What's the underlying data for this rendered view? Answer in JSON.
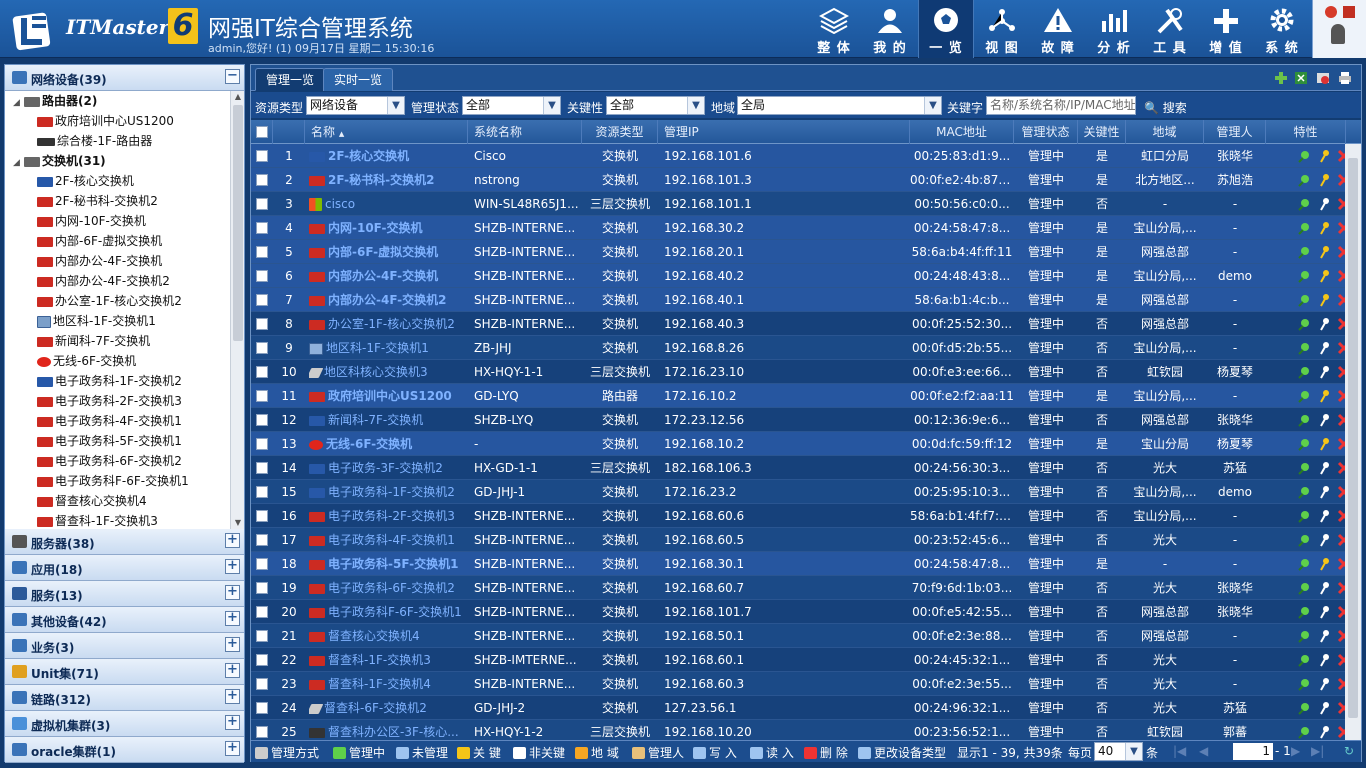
{
  "header": {
    "brand": "ITMaster",
    "brand_num": "6",
    "title": "网强IT综合管理系统",
    "subtitle": "admin,您好! (1) 09月17日 星期二 15:30:16",
    "nav": [
      {
        "label": "整 体",
        "icon": "layers-icon"
      },
      {
        "label": "我 的",
        "icon": "user-icon"
      },
      {
        "label": "一 览",
        "icon": "soccer-icon"
      },
      {
        "label": "视 图",
        "icon": "network-icon"
      },
      {
        "label": "故 障",
        "icon": "warning-icon"
      },
      {
        "label": "分 析",
        "icon": "chart-icon"
      },
      {
        "label": "工 具",
        "icon": "tools-icon"
      },
      {
        "label": "增 值",
        "icon": "plus-icon"
      },
      {
        "label": "系 统",
        "icon": "gear-icon"
      }
    ]
  },
  "sidebar": {
    "sections": [
      {
        "label": "网络设备(39)",
        "icon": "network-device-icon",
        "toggle": "−"
      },
      {
        "label": "服务器(38)",
        "icon": "server-icon",
        "toggle": "+"
      },
      {
        "label": "应用(18)",
        "icon": "app-icon",
        "toggle": "+"
      },
      {
        "label": "服务(13)",
        "icon": "service-icon",
        "toggle": "+"
      },
      {
        "label": "其他设备(42)",
        "icon": "monitor-icon",
        "toggle": "+"
      },
      {
        "label": "业务(3)",
        "icon": "business-icon",
        "toggle": "+"
      },
      {
        "label": "Unit集(71)",
        "icon": "unit-icon",
        "toggle": "+"
      },
      {
        "label": "链路(312)",
        "icon": "link-icon",
        "toggle": "+"
      },
      {
        "label": "虚拟机集群(3)",
        "icon": "cloud-icon",
        "toggle": "+"
      },
      {
        "label": "oracle集群(1)",
        "icon": "db-icon",
        "toggle": "+"
      }
    ],
    "tree": [
      {
        "label": "路由器(2)",
        "level": 0,
        "bold": true,
        "icon": "router-group-icon",
        "exp": "◢"
      },
      {
        "label": "政府培训中心US1200",
        "level": 1,
        "icon": "h3c"
      },
      {
        "label": "综合楼-1F-路由器",
        "level": 1,
        "icon": "dlink"
      },
      {
        "label": "交换机(31)",
        "level": 0,
        "bold": true,
        "icon": "switch-group-icon",
        "exp": "◢"
      },
      {
        "label": "2F-核心交换机",
        "level": 1,
        "icon": "cisco"
      },
      {
        "label": "2F-秘书科-交换机2",
        "level": 1,
        "icon": "h3c"
      },
      {
        "label": "内网-10F-交换机",
        "level": 1,
        "icon": "h3c"
      },
      {
        "label": "内部-6F-虚拟交换机",
        "level": 1,
        "icon": "h3c"
      },
      {
        "label": "内部办公-4F-交换机",
        "level": 1,
        "icon": "h3c"
      },
      {
        "label": "内部办公-4F-交换机2",
        "level": 1,
        "icon": "h3c"
      },
      {
        "label": "办公室-1F-核心交换机2",
        "level": 1,
        "icon": "h3c"
      },
      {
        "label": "地区科-1F-交换机1",
        "level": 1,
        "icon": "pc"
      },
      {
        "label": "新闻科-7F-交换机",
        "level": 1,
        "icon": "h3c"
      },
      {
        "label": "无线-6F-交换机",
        "level": 1,
        "icon": "huawei"
      },
      {
        "label": "电子政务科-1F-交换机2",
        "level": 1,
        "icon": "cisco"
      },
      {
        "label": "电子政务科-2F-交换机3",
        "level": 1,
        "icon": "h3c"
      },
      {
        "label": "电子政务科-4F-交换机1",
        "level": 1,
        "icon": "h3c"
      },
      {
        "label": "电子政务科-5F-交换机1",
        "level": 1,
        "icon": "h3c"
      },
      {
        "label": "电子政务科-6F-交换机2",
        "level": 1,
        "icon": "h3c"
      },
      {
        "label": "电子政务科F-6F-交换机1",
        "level": 1,
        "icon": "h3c"
      },
      {
        "label": "督查核心交换机4",
        "level": 1,
        "icon": "h3c"
      },
      {
        "label": "督查科-1F-交换机3",
        "level": 1,
        "icon": "h3c"
      }
    ]
  },
  "main": {
    "tabs": [
      "管理一览",
      "实时一览"
    ],
    "filter": {
      "type_label": "资源类型",
      "type_value": "网络设备",
      "mgmt_label": "管理状态",
      "mgmt_value": "全部",
      "key_label": "关键性",
      "key_value": "全部",
      "region_label": "地域",
      "region_value": "全局",
      "kw_label": "关键字",
      "kw_placeholder": "名称/系统名称/IP/MAC地址",
      "search": "搜索"
    },
    "columns": [
      "名称",
      "系统名称",
      "资源类型",
      "管理IP",
      "MAC地址",
      "管理状态",
      "关键性",
      "地域",
      "管理人",
      "特性"
    ],
    "sort_indicator": "▲",
    "rows": [
      {
        "n": "1",
        "name": "2F-核心交换机",
        "bold": true,
        "icon": "cisco",
        "sys": "Cisco",
        "type": "交换机",
        "ip": "192.168.101.6",
        "mac": "00:25:83:d1:9...",
        "st": "管理中",
        "key": "是",
        "reg": "虹口分局",
        "mgr": "张晓华"
      },
      {
        "n": "2",
        "name": "2F-秘书科-交换机2",
        "bold": true,
        "icon": "h3c",
        "sys": "nstrong",
        "type": "交换机",
        "ip": "192.168.101.3",
        "mac": "00:0f:e2:4b:87:f4",
        "st": "管理中",
        "key": "是",
        "reg": "北方地区...",
        "mgr": "苏旭浩"
      },
      {
        "n": "3",
        "name": "cisco",
        "bold": false,
        "icon": "ms",
        "sys": "WIN-SL48R65J1...",
        "type": "三层交换机",
        "ip": "192.168.101.1",
        "mac": "00:50:56:c0:0...",
        "st": "管理中",
        "key": "否",
        "reg": "-",
        "mgr": "-"
      },
      {
        "n": "4",
        "name": "内网-10F-交换机",
        "bold": true,
        "icon": "h3c",
        "sys": "SHZB-INTERNE...",
        "type": "交换机",
        "ip": "192.168.30.2",
        "mac": "00:24:58:47:8...",
        "st": "管理中",
        "key": "是",
        "reg": "宝山分局,...",
        "mgr": "-"
      },
      {
        "n": "5",
        "name": "内部-6F-虚拟交换机",
        "bold": true,
        "icon": "h3c",
        "sys": "SHZB-INTERNE...",
        "type": "交换机",
        "ip": "192.168.20.1",
        "mac": "58:6a:b4:4f:ff:11",
        "st": "管理中",
        "key": "是",
        "reg": "网强总部",
        "mgr": "-"
      },
      {
        "n": "6",
        "name": "内部办公-4F-交换机",
        "bold": true,
        "icon": "h3c",
        "sys": "SHZB-INTERNE...",
        "type": "交换机",
        "ip": "192.168.40.2",
        "mac": "00:24:48:43:8...",
        "st": "管理中",
        "key": "是",
        "reg": "宝山分局,...",
        "mgr": "demo"
      },
      {
        "n": "7",
        "name": "内部办公-4F-交换机2",
        "bold": true,
        "icon": "h3c",
        "sys": "SHZB-INTERNE...",
        "type": "交换机",
        "ip": "192.168.40.1",
        "mac": "58:6a:b1:4c:b...",
        "st": "管理中",
        "key": "是",
        "reg": "网强总部",
        "mgr": "-"
      },
      {
        "n": "8",
        "name": "办公室-1F-核心交换机2",
        "bold": false,
        "icon": "h3c",
        "sys": "SHZB-INTERNE...",
        "type": "交换机",
        "ip": "192.168.40.3",
        "mac": "00:0f:25:52:30...",
        "st": "管理中",
        "key": "否",
        "reg": "网强总部",
        "mgr": "-"
      },
      {
        "n": "9",
        "name": "地区科-1F-交换机1",
        "bold": false,
        "icon": "pc",
        "sys": "ZB-JHJ",
        "type": "交换机",
        "ip": "192.168.8.26",
        "mac": "00:0f:d5:2b:55...",
        "st": "管理中",
        "key": "否",
        "reg": "宝山分局,...",
        "mgr": "-"
      },
      {
        "n": "10",
        "name": "地区科核心交换机3",
        "bold": false,
        "icon": "sl",
        "sys": "HX-HQY-1-1",
        "type": "三层交换机",
        "ip": "172.16.23.10",
        "mac": "00:0f:e3:ee:66...",
        "st": "管理中",
        "key": "否",
        "reg": "虹钦园",
        "mgr": "杨夏琴"
      },
      {
        "n": "11",
        "name": "政府培训中心US1200",
        "bold": true,
        "icon": "h3c",
        "sys": "GD-LYQ",
        "type": "路由器",
        "ip": "172.16.10.2",
        "mac": "00:0f:e2:f2:aa:11",
        "st": "管理中",
        "key": "是",
        "reg": "宝山分局,...",
        "mgr": "-"
      },
      {
        "n": "12",
        "name": "新闻科-7F-交换机",
        "bold": false,
        "icon": "cisco",
        "sys": "SHZB-LYQ",
        "type": "交换机",
        "ip": "172.23.12.56",
        "mac": "00:12:36:9e:6...",
        "st": "管理中",
        "key": "否",
        "reg": "网强总部",
        "mgr": "张晓华"
      },
      {
        "n": "13",
        "name": "无线-6F-交换机",
        "bold": true,
        "icon": "hw",
        "sys": "-",
        "type": "交换机",
        "ip": "192.168.10.2",
        "mac": "00:0d:fc:59:ff:12",
        "st": "管理中",
        "key": "是",
        "reg": "宝山分局",
        "mgr": "杨夏琴"
      },
      {
        "n": "14",
        "name": "电子政务-3F-交换机2",
        "bold": false,
        "icon": "b",
        "sys": "HX-GD-1-1",
        "type": "三层交换机",
        "ip": "182.168.106.3",
        "mac": "00:24:56:30:3...",
        "st": "管理中",
        "key": "否",
        "reg": "光大",
        "mgr": "苏猛"
      },
      {
        "n": "15",
        "name": "电子政务科-1F-交换机2",
        "bold": false,
        "icon": "cisco",
        "sys": "GD-JHJ-1",
        "type": "交换机",
        "ip": "172.16.23.2",
        "mac": "00:25:95:10:3...",
        "st": "管理中",
        "key": "否",
        "reg": "宝山分局,...",
        "mgr": "demo"
      },
      {
        "n": "16",
        "name": "电子政务科-2F-交换机3",
        "bold": false,
        "icon": "h3c",
        "sys": "SHZB-INTERNE...",
        "type": "交换机",
        "ip": "192.168.60.6",
        "mac": "58:6a:b1:4f:f7:bb",
        "st": "管理中",
        "key": "否",
        "reg": "宝山分局,...",
        "mgr": "-"
      },
      {
        "n": "17",
        "name": "电子政务科-4F-交换机1",
        "bold": false,
        "icon": "h3c",
        "sys": "SHZB-INTERNE...",
        "type": "交换机",
        "ip": "192.168.60.5",
        "mac": "00:23:52:45:6...",
        "st": "管理中",
        "key": "否",
        "reg": "光大",
        "mgr": "-"
      },
      {
        "n": "18",
        "name": "电子政务科-5F-交换机1",
        "bold": true,
        "icon": "h3c",
        "sys": "SHZB-INTERNE...",
        "type": "交换机",
        "ip": "192.168.30.1",
        "mac": "00:24:58:47:8...",
        "st": "管理中",
        "key": "是",
        "reg": "-",
        "mgr": "-"
      },
      {
        "n": "19",
        "name": "电子政务科-6F-交换机2",
        "bold": false,
        "icon": "h3c",
        "sys": "SHZB-INTERNE...",
        "type": "交换机",
        "ip": "192.168.60.7",
        "mac": "70:f9:6d:1b:03...",
        "st": "管理中",
        "key": "否",
        "reg": "光大",
        "mgr": "张晓华"
      },
      {
        "n": "20",
        "name": "电子政务科F-6F-交换机1",
        "bold": false,
        "icon": "h3c",
        "sys": "SHZB-INTERNE...",
        "type": "交换机",
        "ip": "192.168.101.7",
        "mac": "00:0f:e5:42:55...",
        "st": "管理中",
        "key": "否",
        "reg": "网强总部",
        "mgr": "张晓华"
      },
      {
        "n": "21",
        "name": "督查核心交换机4",
        "bold": false,
        "icon": "h3c",
        "sys": "SHZB-INTERNE...",
        "type": "交换机",
        "ip": "192.168.50.1",
        "mac": "00:0f:e2:3e:88...",
        "st": "管理中",
        "key": "否",
        "reg": "网强总部",
        "mgr": "-"
      },
      {
        "n": "22",
        "name": "督查科-1F-交换机3",
        "bold": false,
        "icon": "h3c",
        "sys": "SHZB-IMTERNE...",
        "type": "交换机",
        "ip": "192.168.60.1",
        "mac": "00:24:45:32:1...",
        "st": "管理中",
        "key": "否",
        "reg": "光大",
        "mgr": "-"
      },
      {
        "n": "23",
        "name": "督查科-1F-交换机4",
        "bold": false,
        "icon": "h3c",
        "sys": "SHZB-INTERNE...",
        "type": "交换机",
        "ip": "192.168.60.3",
        "mac": "00:0f:e2:3e:55...",
        "st": "管理中",
        "key": "否",
        "reg": "光大",
        "mgr": "-"
      },
      {
        "n": "24",
        "name": "督查科-6F-交换机2",
        "bold": false,
        "icon": "sl",
        "sys": "GD-JHJ-2",
        "type": "交换机",
        "ip": "127.23.56.1",
        "mac": "00:24:96:32:1...",
        "st": "管理中",
        "key": "否",
        "reg": "光大",
        "mgr": "苏猛"
      },
      {
        "n": "25",
        "name": "督查科办公区-3F-核心...",
        "bold": false,
        "icon": "k",
        "sys": "HX-HQY-1-2",
        "type": "三层交换机",
        "ip": "192.168.10.20",
        "mac": "00:23:56:52:1...",
        "st": "管理中",
        "key": "否",
        "reg": "虹钦园",
        "mgr": "郭蕃"
      }
    ],
    "bottom": {
      "buttons": [
        "管理方式",
        "管理中",
        "未管理",
        "关 键",
        "非关键",
        "地 域",
        "管理人",
        "写 入",
        "读 入",
        "删 除",
        "更改设备类型"
      ],
      "display": "显示1 - 39, 共39条",
      "per_page_label": "每页",
      "per_page": "40",
      "per_page_unit": "条",
      "page": "1",
      "page_total": "- 1"
    }
  },
  "colors": {
    "accent": "#2468b4",
    "link": "#7fb2ff",
    "active_nav": "#0f3a74"
  }
}
